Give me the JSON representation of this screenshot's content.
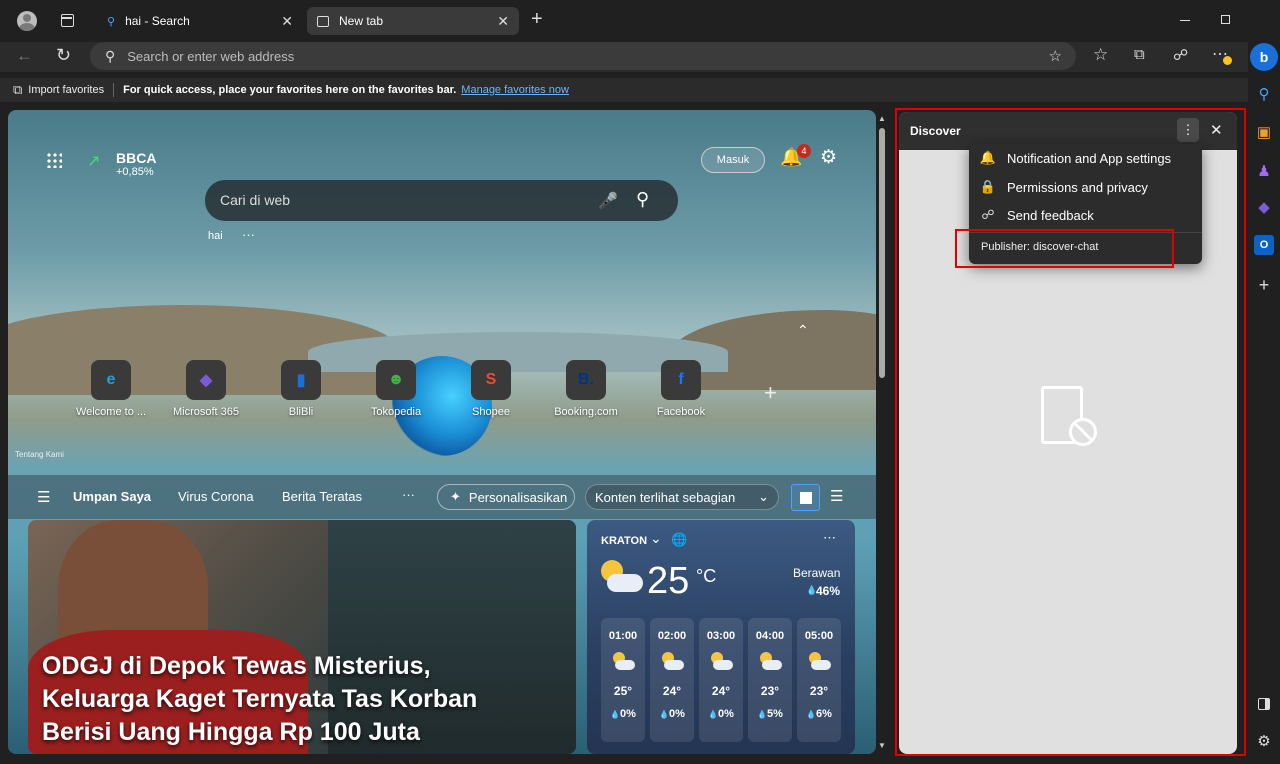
{
  "tabs": [
    {
      "title": "hai - Search",
      "icon": "search-icon",
      "active": false
    },
    {
      "title": "New tab",
      "icon": "newtab-icon",
      "active": true
    }
  ],
  "toolbar": {
    "address_placeholder": "Search or enter web address"
  },
  "favorites_bar": {
    "import_label": "Import favorites",
    "message": "For quick access, place your favorites here on the favorites bar.",
    "manage_link": "Manage favorites now"
  },
  "newtab": {
    "stock": {
      "symbol": "BBCA",
      "change": "+0,85%"
    },
    "signin_label": "Masuk",
    "notification_count": "4",
    "search_placeholder": "Cari di web",
    "recent_search": "hai",
    "more_dots": "···",
    "about_label": "Tentang Kami",
    "quick_links": [
      {
        "label": "Welcome to ...",
        "glyph": "e",
        "color": "#2c9ad8"
      },
      {
        "label": "Microsoft 365",
        "glyph": "◆",
        "color": "#7b5cd6"
      },
      {
        "label": "BliBli",
        "glyph": "▮",
        "color": "#1a6fd8"
      },
      {
        "label": "Tokopedia",
        "glyph": "☻",
        "color": "#42b549"
      },
      {
        "label": "Shopee",
        "glyph": "S",
        "color": "#ee4d2d"
      },
      {
        "label": "Booking.com",
        "glyph": "B.",
        "color": "#003580"
      },
      {
        "label": "Facebook",
        "glyph": "f",
        "color": "#1877f2"
      }
    ],
    "add_label": "+",
    "feed_tabs": [
      "Umpan Saya",
      "Virus Corona",
      "Berita Teratas"
    ],
    "feed_more": "···",
    "personalize_label": "Personalisasikan",
    "content_visibility": "Konten terlihat sebagian",
    "news_headline": "ODGJ di Depok Tewas Misterius, Keluarga Kaget Ternyata Tas Korban Berisi Uang Hingga Rp 100 Juta",
    "weather": {
      "location": "KRATON",
      "temp": "25",
      "unit": "°C",
      "condition": "Berawan",
      "humidity": "46%",
      "hours": [
        {
          "time": "01:00",
          "temp": "25°",
          "precip": "0%"
        },
        {
          "time": "02:00",
          "temp": "24°",
          "precip": "0%"
        },
        {
          "time": "03:00",
          "temp": "24°",
          "precip": "0%"
        },
        {
          "time": "04:00",
          "temp": "23°",
          "precip": "5%"
        },
        {
          "time": "05:00",
          "temp": "23°",
          "precip": "6%"
        }
      ]
    }
  },
  "discover": {
    "title": "Discover",
    "menu": [
      {
        "label": "Notification and App settings",
        "icon": "bell-icon"
      },
      {
        "label": "Permissions and privacy",
        "icon": "lock-icon"
      },
      {
        "label": "Send feedback",
        "icon": "feedback-icon"
      }
    ],
    "publisher": "Publisher: discover-chat"
  }
}
